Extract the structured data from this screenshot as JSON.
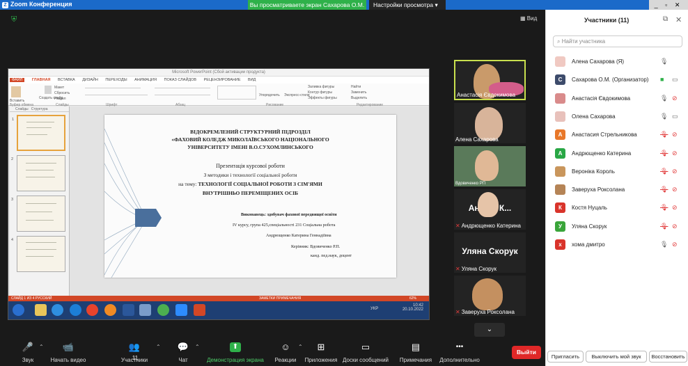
{
  "window": {
    "title": "Zoom Конференция",
    "share_banner": "Вы просматриваете экран Сахарова О.М.",
    "view_options": "Настройки просмотра",
    "view_label": "Вид",
    "controls": "_ ▫ ✕"
  },
  "powerpoint": {
    "title_bar": "Microsoft PowerPoint (Сбой активации продукта)",
    "tabs": [
      "ФАЙЛ",
      "ГЛАВНАЯ",
      "ВСТАВКА",
      "ДИЗАЙН",
      "ПЕРЕХОДЫ",
      "АНИМАЦИЯ",
      "ПОКАЗ СЛАЙДОВ",
      "РЕЦЕНЗИРОВАНИЕ",
      "ВИД"
    ],
    "ribbon_groups": [
      "Буфер обмена",
      "Слайды",
      "Шрифт",
      "Абзац",
      "Рисование",
      "Редактирование"
    ],
    "ribbon_items": [
      "Вставить",
      "Макет",
      "Сбросить",
      "Создать слайд",
      "Раздел",
      "Упорядочить",
      "Экспресс-стили",
      "Заливка фигуры",
      "Контур фигуры",
      "Эффекты фигуры",
      "Найти",
      "Заменить",
      "Выделить"
    ],
    "thumb_tabs": [
      "Слайды",
      "Структура"
    ],
    "thumb_numbers": [
      "1",
      "2",
      "3",
      "4"
    ],
    "slide": {
      "lines": [
        "ВІДОКРЕМЛЕНИЙ СТРУКТУРНИЙ ПІДРОЗДІЛ",
        "«ФАХОВИЙ КОЛЕДЖ МИКОЛАЇВСЬКОГО НАЦІОНАЛЬНОГО",
        "УНІВЕРСИТЕТУ ІМЕНІ В.О.СУХОМЛИНСЬКОГО"
      ],
      "pres1": "Презентація курсової роботи",
      "pres2": "З методики і технології соціальної роботи",
      "topic_prefix": "на тему:",
      "topic1": "ТЕХНОЛОГІЇ СОЦІАЛЬНОЇ РОБОТИ З СІМ'ЯМИ",
      "topic2": "ВНУТРІШНЬО ПЕРЕМІЩЕНИХ ОСІБ",
      "author1": "Виконавець: здобувач фахової передвищої освіти",
      "author2": "IV курсу, група 425,спеціальності 231 Соціальна робота",
      "author3": "Андрющенко Катерина Геннадіївна",
      "sup1": "Керівник: Вдовиченко Р.П.",
      "sup2": "канд. пед.наук, доцент"
    },
    "status_left": "СЛАЙД 1 ИЗ 4   РУССКИЙ",
    "status_notes": "ЗАМЕТКИ   ПРИМЕЧАНИЯ",
    "zoom": "62%",
    "task_time": "10:42",
    "task_date": "20.10.2022",
    "task_lang": "УКР"
  },
  "tiles": [
    {
      "name": "Анастасія Євдокимова",
      "muted": false
    },
    {
      "name": "Алена Сахарова",
      "muted": false
    },
    {
      "name": "Вдовиченко РП",
      "muted": false
    },
    {
      "name": "Андрющенко Катерина",
      "big": "Андр... К...",
      "muted": true
    },
    {
      "name": "Уляна Скорук",
      "big": "Уляна Скорук",
      "muted": true
    },
    {
      "name": "Заверуха Роксолана",
      "muted": true
    }
  ],
  "toolbar": [
    {
      "label": "Звук",
      "icon": "🎤"
    },
    {
      "label": "Начать видео",
      "icon": "📹"
    },
    {
      "label": "Участники",
      "icon": "👥",
      "count": "11"
    },
    {
      "label": "Чат",
      "icon": "💬"
    },
    {
      "label": "Демонстрация экрана",
      "icon": "⬆"
    },
    {
      "label": "Реакции",
      "icon": "☺"
    },
    {
      "label": "Приложения",
      "icon": "⊞"
    },
    {
      "label": "Доски сообщений",
      "icon": "▭"
    },
    {
      "label": "Примечания",
      "icon": "▤"
    },
    {
      "label": "Дополнительно",
      "icon": "•••"
    }
  ],
  "leave": "Выйти",
  "panel": {
    "title": "Участники (11)",
    "search_placeholder": "Найти участника",
    "participants": [
      {
        "name": "Алена Сахарова (Я)",
        "initial": "",
        "color": "#f0c9c2",
        "mic": "on",
        "video": "none"
      },
      {
        "name": "Сахарова О.М. (Организатор)",
        "initial": "С",
        "color": "#3d4b6b",
        "mic": "share",
        "video": "on"
      },
      {
        "name": "Анастасія Євдокимова",
        "initial": "",
        "color": "#d98b8b",
        "mic": "on",
        "video": "off"
      },
      {
        "name": "Олена Сахарова",
        "initial": "",
        "color": "#e8c1bb",
        "mic": "on",
        "video": "on"
      },
      {
        "name": "Анастасия Стрельникова",
        "initial": "А",
        "color": "#e8782a",
        "mic": "off",
        "video": "off"
      },
      {
        "name": "Андрющенко Катерина",
        "initial": "А",
        "color": "#29a745",
        "mic": "off",
        "video": "off"
      },
      {
        "name": "Вероніка Король",
        "initial": "",
        "color": "#c9965c",
        "mic": "off",
        "video": "off"
      },
      {
        "name": "Заверуха Роксолана",
        "initial": "",
        "color": "#b58456",
        "mic": "off",
        "video": "off"
      },
      {
        "name": "Костя Нуцаль",
        "initial": "К",
        "color": "#d9342b",
        "mic": "off",
        "video": "off"
      },
      {
        "name": "Уляна Скорук",
        "initial": "У",
        "color": "#3aa53a",
        "mic": "off",
        "video": "off"
      },
      {
        "name": "хома дмитро",
        "initial": "х",
        "color": "#d9342b",
        "mic": "on",
        "video": "off"
      }
    ],
    "footer": [
      "Пригласить",
      "Выключить мой звук",
      "Восстановить"
    ]
  }
}
